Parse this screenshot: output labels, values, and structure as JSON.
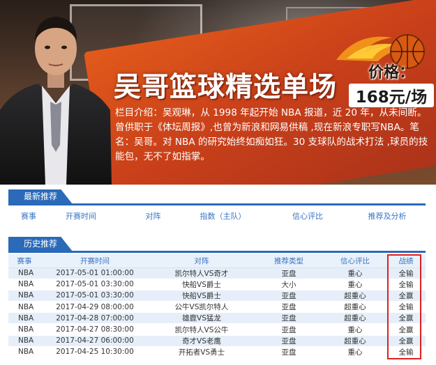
{
  "banner": {
    "title": "吴哥篮球精选单场",
    "price_label": "价格：",
    "price_value": "168元/场",
    "intro": "栏目介绍：吴观琳，从 1998 年起开始 NBA 报道，近 20 年，从未间断。曾供职于《体坛周报》,也曾为新浪和网易供稿 ,现在新浪专职写NBA。笔名：吴哥。对 NBA 的研究始终如痴如狂。30 支球队的战术打法 ,球员的技能包，无不了如指掌。"
  },
  "latest": {
    "tab_label": "最新推荐",
    "columns": [
      "赛事",
      "开赛时间",
      "对阵",
      "指数（主队）",
      "信心评比",
      "推荐及分析"
    ]
  },
  "history": {
    "tab_label": "历史推荐",
    "columns": [
      "赛事",
      "开赛时间",
      "对阵",
      "推荐类型",
      "信心评比",
      "战绩"
    ],
    "rows": [
      {
        "sport": "NBA",
        "time": "2017-05-01 01:00:00",
        "match": "凯尔特人VS奇才",
        "type": "亚盘",
        "confidence": "重心",
        "result": "全输"
      },
      {
        "sport": "NBA",
        "time": "2017-05-01 03:30:00",
        "match": "快船VS爵士",
        "type": "大小",
        "confidence": "重心",
        "result": "全输"
      },
      {
        "sport": "NBA",
        "time": "2017-05-01 03:30:00",
        "match": "快船VS爵士",
        "type": "亚盘",
        "confidence": "超重心",
        "result": "全赢"
      },
      {
        "sport": "NBA",
        "time": "2017-04-29 08:00:00",
        "match": "公牛VS凯尔特人",
        "type": "亚盘",
        "confidence": "超重心",
        "result": "全输"
      },
      {
        "sport": "NBA",
        "time": "2017-04-28 07:00:00",
        "match": "雄鹿VS猛龙",
        "type": "亚盘",
        "confidence": "超重心",
        "result": "全赢"
      },
      {
        "sport": "NBA",
        "time": "2017-04-27 08:30:00",
        "match": "凯尔特人VS公牛",
        "type": "亚盘",
        "confidence": "重心",
        "result": "全赢"
      },
      {
        "sport": "NBA",
        "time": "2017-04-27 06:00:00",
        "match": "奇才VS老鹰",
        "type": "亚盘",
        "confidence": "超重心",
        "result": "全赢"
      },
      {
        "sport": "NBA",
        "time": "2017-04-25 10:30:00",
        "match": "开拓者VS勇士",
        "type": "亚盘",
        "confidence": "重心",
        "result": "全输"
      }
    ]
  },
  "colors": {
    "accent_blue": "#2a6ab8",
    "highlight_red": "#e02020",
    "banner_orange": "#e25a1b"
  }
}
